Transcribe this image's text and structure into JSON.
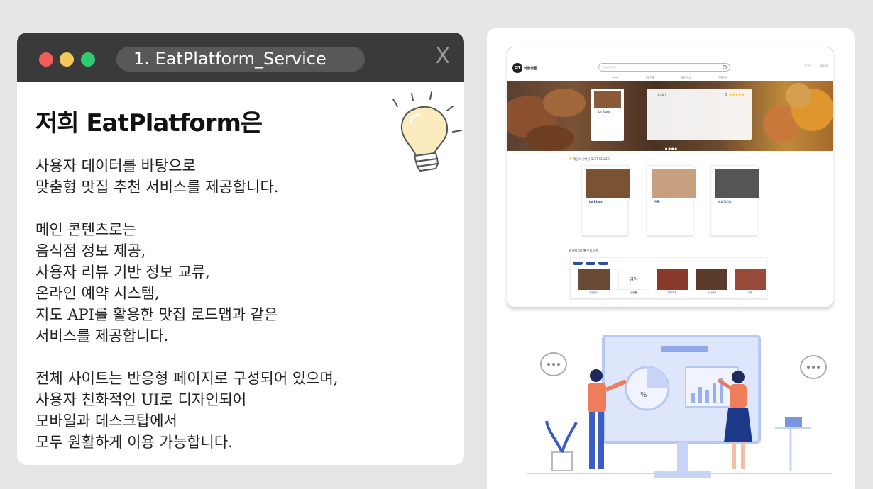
{
  "window": {
    "tab_title": "1. EatPlatform_Service",
    "close_glyph": "X"
  },
  "content": {
    "heading": "저희 EatPlatform은",
    "paragraphs": [
      [
        "사용자 데이터를 바탕으로",
        "맞춤형 맛집 추천 서비스를 제공합니다."
      ],
      [
        "메인 콘텐츠로는",
        "음식점 정보 제공,",
        "사용자 리뷰 기반 정보 교류,",
        "온라인 예약 시스템,",
        "지도 API를 활용한 맛집 로드맵과 같은",
        "서비스를 제공합니다."
      ],
      [
        "전체 사이트는 반응형 페이지로 구성되어 있으며,",
        "사용자 친화적인 UI로 디자인되어",
        "모바일과 데스크탑에서",
        "모두 원활하게 이용 가능합니다."
      ]
    ]
  },
  "mock_site": {
    "logo_mark": "EiT",
    "logo_text": "먹플랫폼",
    "search_placeholder": "검색어를 입력",
    "header_links": [
      "로그인",
      "회원가입"
    ],
    "nav": [
      "Home",
      "맛집 지도",
      "맛집 리스트",
      "커뮤니티"
    ],
    "hero": {
      "card_name": "Le Blanc",
      "reviewer": "L.seri",
      "rating_value": "5",
      "stars": "★★★★★"
    },
    "best_section_title": "먹인이 선택한 BEST SELLER",
    "best": [
      {
        "name": "Le Blanc"
      },
      {
        "name": "한울"
      },
      {
        "name": "삼피이기시"
      }
    ],
    "category_section_title": "카테고리 별 맛집 검색",
    "categories": [
      "당엔한우",
      "곱탕뽑",
      "별미리젼",
      "신사정모",
      "우정"
    ],
    "category_logo": "곱탕"
  },
  "colors": {
    "titlebar": "#3a3a3a",
    "accent_blue": "#2a4fa0",
    "dot_red": "#f25c5c",
    "dot_yellow": "#f5c85a",
    "dot_green": "#2ecc71"
  }
}
